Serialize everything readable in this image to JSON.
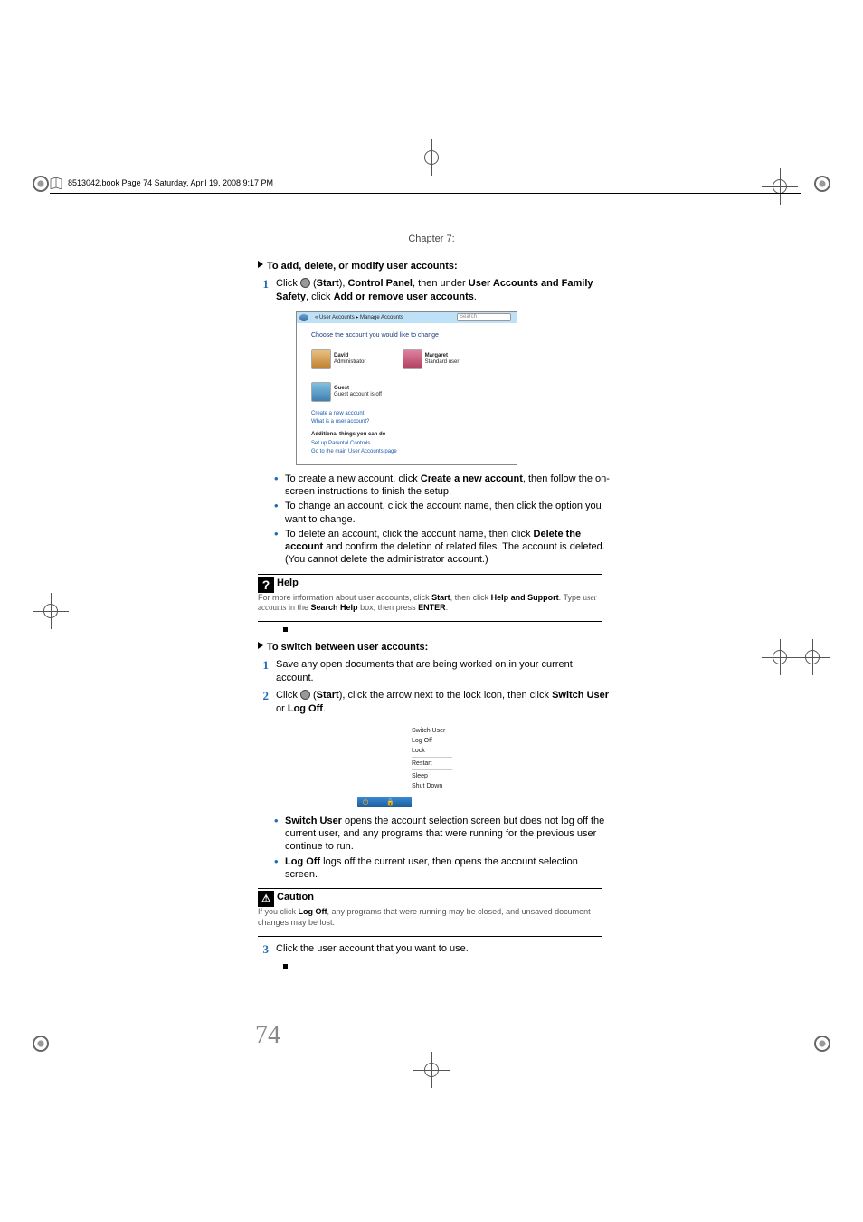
{
  "header": {
    "running": "8513042.book  Page 74  Saturday, April 19, 2008  9:17 PM",
    "chapter": "Chapter 7:"
  },
  "proc1": {
    "title": "To add, delete, or modify user accounts:",
    "step1_num": "1",
    "step1_a": "Click ",
    "step1_b": " (",
    "step1_start": "Start",
    "step1_c": "), ",
    "step1_cp": "Control Panel",
    "step1_d": ", then under ",
    "step1_uav": "User Accounts and Family Safety",
    "step1_e": ", click ",
    "step1_add": "Add or remove user accounts",
    "step1_f": "."
  },
  "ss": {
    "crumb": "« User Accounts ▸ Manage Accounts",
    "search_ph": "Search",
    "heading": "Choose the account you would like to change",
    "a1": "David",
    "a1s": "Administrator",
    "a2": "Margaret",
    "a2s": "Standard user",
    "a3": "Guest",
    "a3s": "Guest account is off",
    "l1": "Create a new account",
    "l2": "What is a user account?",
    "m": "Additional things you can do",
    "l3": "Set up Parental Controls",
    "l4": "Go to the main User Accounts page"
  },
  "bullets1": {
    "b1a": "To create a new account, click ",
    "b1b": "Create a new account",
    "b1c": ", then follow the on-screen instructions to finish the setup.",
    "b2": "To change an account, click the account name, then click the option you want to change.",
    "b3a": "To delete an account, click the account name, then click ",
    "b3b": "Delete the account",
    "b3c": " and confirm the deletion of related files. The account is deleted. (You cannot delete the administrator account.)"
  },
  "help": {
    "icon": "?",
    "title": "Help",
    "t1": "For more information about user accounts, click ",
    "s1": "Start",
    "t2": ", then click ",
    "s2": "Help and Support",
    "t3": ". Type ",
    "kw": "user accounts",
    "t4": " in the ",
    "s3": "Search Help",
    "t5": " box, then press ",
    "s4": "ENTER",
    "t6": "."
  },
  "proc2": {
    "title": "To switch between user accounts:",
    "step1_num": "1",
    "step1": "Save any open documents that are being worked on in your current account.",
    "step2_num": "2",
    "step2_a": "Click ",
    "step2_b": " (",
    "step2_start": "Start",
    "step2_c": "), click the arrow next to the lock icon, then click ",
    "step2_su": "Switch User",
    "step2_d": " or ",
    "step2_lo": "Log Off",
    "step2_e": "."
  },
  "menu": {
    "m1": "Switch User",
    "m2": "Log Off",
    "m3": "Lock",
    "m4": "Restart",
    "m5": "Sleep",
    "m6": "Shut Down"
  },
  "bullets2": {
    "b1a": "Switch User",
    "b1b": " opens the account selection screen but does not log off the current user, and any programs that were running for the previous user continue to run.",
    "b2a": "Log Off",
    "b2b": " logs off the current user, then opens the account selection screen."
  },
  "caution": {
    "icon": "!",
    "title": "Caution",
    "t1": "If you click ",
    "s1": "Log Off",
    "t2": ", any programs that were running may be closed, and unsaved document changes may be lost."
  },
  "step3": {
    "num": "3",
    "text": "Click the user account that you want to use."
  },
  "pagenum": "74"
}
